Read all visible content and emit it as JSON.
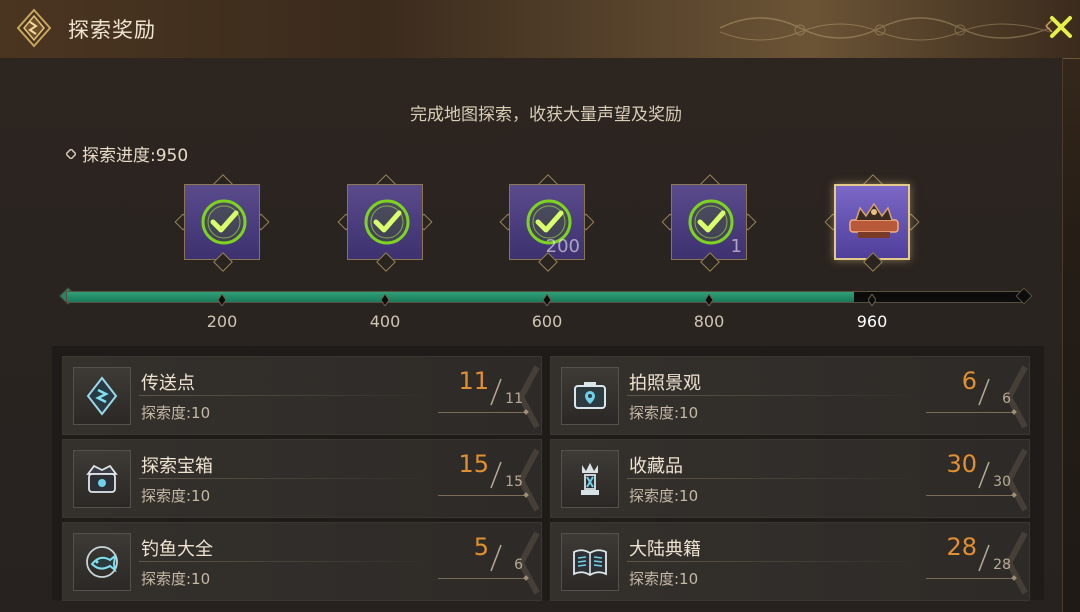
{
  "window": {
    "title": "探索奖励",
    "emblem_icon": "diamond-emblem-icon",
    "close_icon": "close-icon"
  },
  "header": {
    "subtitle": "完成地图探索，收获大量声望及奖励",
    "progress_label": "探索进度:950"
  },
  "progress": {
    "current": 950,
    "max": 960,
    "fill_fraction": 0.822,
    "ticks": [
      "200",
      "400",
      "600",
      "800",
      "960"
    ]
  },
  "milestones": [
    {
      "threshold": "200",
      "claimed": true,
      "quantity": ""
    },
    {
      "threshold": "400",
      "claimed": true,
      "quantity": ""
    },
    {
      "threshold": "600",
      "claimed": true,
      "quantity": "200"
    },
    {
      "threshold": "800",
      "claimed": true,
      "quantity": "1"
    },
    {
      "threshold": "960",
      "claimed": false,
      "quantity": "",
      "icon": "frame-decoration-icon"
    }
  ],
  "categories": [
    {
      "name": "传送点",
      "sub": "探索度:10",
      "current": "11",
      "total": "11",
      "icon": "teleport-crystal-icon"
    },
    {
      "name": "拍照景观",
      "sub": "探索度:10",
      "current": "6",
      "total": "6",
      "icon": "camera-location-icon"
    },
    {
      "name": "探索宝箱",
      "sub": "探索度:10",
      "current": "15",
      "total": "15",
      "icon": "treasure-chest-icon"
    },
    {
      "name": "收藏品",
      "sub": "探索度:10",
      "current": "30",
      "total": "30",
      "icon": "collectible-statue-icon"
    },
    {
      "name": "钓鱼大全",
      "sub": "探索度:10",
      "current": "5",
      "total": "6",
      "icon": "fish-icon"
    },
    {
      "name": "大陆典籍",
      "sub": "探索度:10",
      "current": "28",
      "total": "28",
      "icon": "open-book-icon"
    }
  ],
  "colors": {
    "accent_orange": "#e09030",
    "progress_green": "#1e8a66",
    "check_green": "#7ed321",
    "panel_purple": "#4f3f9a"
  }
}
